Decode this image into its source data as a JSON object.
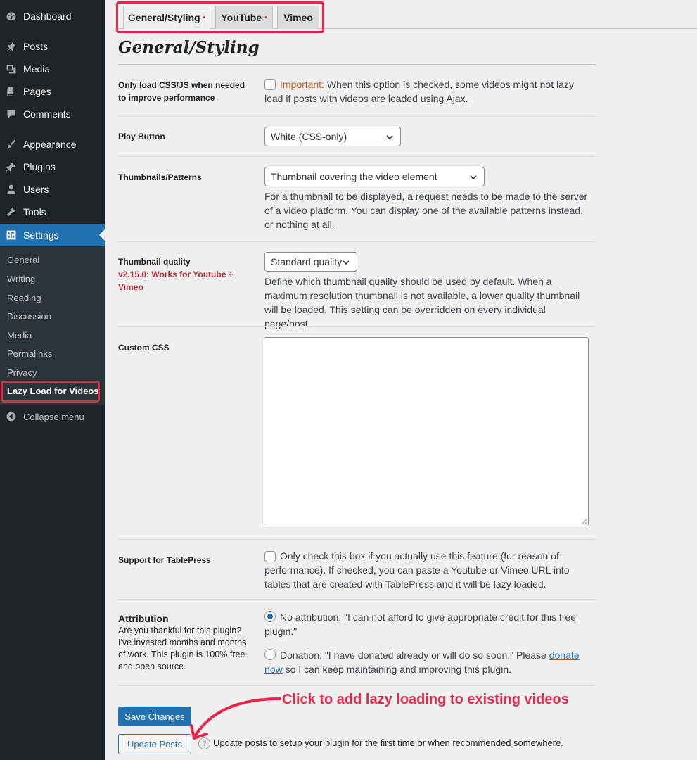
{
  "sidebar": {
    "menu": [
      {
        "label": "Dashboard",
        "icon": "dashboard-icon"
      },
      {
        "label": "Posts",
        "icon": "pin-icon"
      },
      {
        "label": "Media",
        "icon": "media-icon"
      },
      {
        "label": "Pages",
        "icon": "pages-icon"
      },
      {
        "label": "Comments",
        "icon": "comment-icon"
      },
      {
        "label": "Appearance",
        "icon": "brush-icon"
      },
      {
        "label": "Plugins",
        "icon": "plugin-icon"
      },
      {
        "label": "Users",
        "icon": "user-icon"
      },
      {
        "label": "Tools",
        "icon": "wrench-icon"
      },
      {
        "label": "Settings",
        "icon": "settings-icon"
      }
    ],
    "submenu": [
      "General",
      "Writing",
      "Reading",
      "Discussion",
      "Media",
      "Permalinks",
      "Privacy",
      "Lazy Load for Videos"
    ],
    "collapse_label": "Collapse menu"
  },
  "tabs": [
    {
      "label": "General/Styling",
      "dot": "•"
    },
    {
      "label": "YouTube",
      "dot": "•"
    },
    {
      "label": "Vimeo",
      "dot": ""
    }
  ],
  "page_title": "General/Styling",
  "settings": {
    "css_js": {
      "label": "Only load CSS/JS when needed to improve performance",
      "important": "Important:",
      "text": " When this option is checked, some videos might not lazy load if posts with videos are loaded using Ajax."
    },
    "play_button": {
      "label": "Play Button",
      "value": "White (CSS-only)"
    },
    "thumbnails": {
      "label": "Thumbnails/Patterns",
      "value": "Thumbnail covering the video element",
      "desc": "For a thumbnail to be displayed, a request needs to be made to the server of a video platform. You can display one of the available patterns instead, or nothing at all."
    },
    "quality": {
      "label": "Thumbnail quality",
      "note": "v2.15.0: Works for Youtube + Vimeo",
      "value": "Standard quality",
      "desc": "Define which thumbnail quality should be used by default. When a maximum resolution thumbnail is not available, a lower quality thumbnail will be loaded. This setting can be overridden on every individual page/post."
    },
    "custom_css": {
      "label": "Custom CSS"
    },
    "tablepress": {
      "label": "Support for TablePress",
      "text": "Only check this box if you actually use this feature (for reason of performance). If checked, you can paste a Youtube or Vimeo URL into tables that are created with TablePress and it will be lazy loaded."
    },
    "attribution": {
      "title": "Attribution",
      "desc": "Are you thankful for this plugin? I've invested months and months of work. This plugin is 100% free and open source.",
      "option1": "No attribution: \"I can not afford to give appropriate credit for this free plugin.\"",
      "option2_pre": "Donation: \"I have donated already or will do so soon.\" Please ",
      "option2_link": "donate now",
      "option2_post": " so I can keep maintaining and improving this plugin."
    }
  },
  "buttons": {
    "save": "Save Changes",
    "update": "Update Posts",
    "help_glyph": "?",
    "help_text": "Update posts to setup your plugin for the first time or when recommended somewhere."
  },
  "annotation": "Click to add lazy loading to existing videos",
  "colors": {
    "accent": "#2271b1",
    "highlight": "#e8284a",
    "sidebar": "#1d2327"
  }
}
